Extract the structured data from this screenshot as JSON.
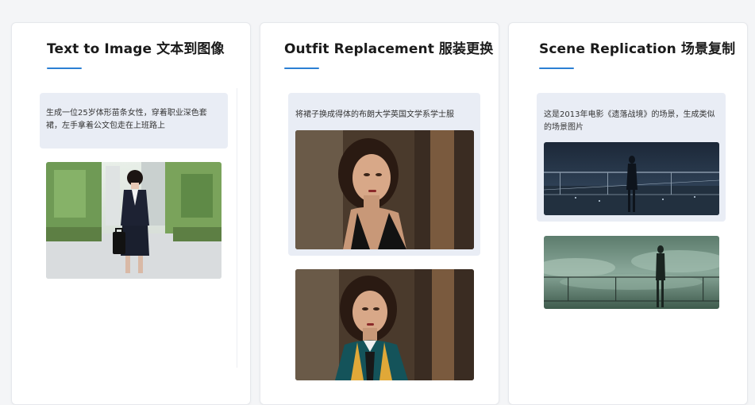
{
  "cards": [
    {
      "title_en": "Text to Image",
      "title_zh": "文本到图像",
      "prompt": "生成一位25岁体形苗条女性，穿着职业深色套裙，左手拿着公文包走在上班路上"
    },
    {
      "title_en": "Outfit Replacement",
      "title_zh": "服装更换",
      "prompt": "将裙子换成得体的布朗大学英国文学系学士服"
    },
    {
      "title_en": "Scene Replication",
      "title_zh": "场景复制",
      "prompt": "这是2013年电影《遗落战境》的场景，生成类似的场景图片"
    }
  ],
  "colors": {
    "accent": "#2b7fd4",
    "prompt_bg": "#e9edf5",
    "page_bg": "#f4f5f7"
  }
}
